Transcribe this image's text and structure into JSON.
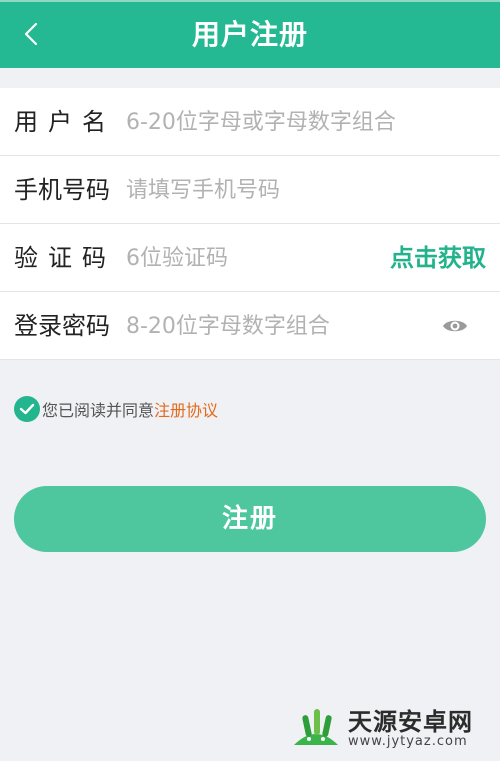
{
  "header": {
    "title": "用户注册",
    "back_icon": "chevron-left-icon",
    "bg_color": "#24b992"
  },
  "form": {
    "username": {
      "label": "用户名",
      "placeholder": "6-20位字母或字母数字组合",
      "value": ""
    },
    "phone": {
      "label": "手机号码",
      "placeholder": "请填写手机号码",
      "value": ""
    },
    "code": {
      "label": "验证码",
      "placeholder": "6位验证码",
      "value": "",
      "action_label": "点击获取"
    },
    "password": {
      "label": "登录密码",
      "placeholder": "8-20位字母数字组合",
      "value": "",
      "toggle_icon": "eye-icon"
    }
  },
  "agreement": {
    "checked": true,
    "text": "您已阅读并同意",
    "link_text": "注册协议",
    "link_color": "#e36a1c"
  },
  "submit": {
    "label": "注册",
    "color": "#4ec69e"
  },
  "watermark": {
    "name": "天源安卓网",
    "url": "www.jytyaz.com"
  }
}
